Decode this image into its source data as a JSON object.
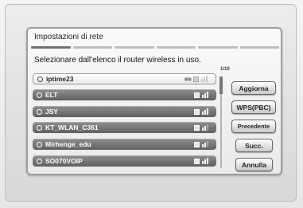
{
  "dialog": {
    "title": "Impostazioni di rete",
    "instruction": "Selezionare dall'elenco il router wireless in uso.",
    "page_counter": "1/10",
    "progress_segments": [
      true,
      false,
      false,
      false,
      false,
      false
    ]
  },
  "networks": [
    {
      "ssid": "iptime23",
      "selected": true,
      "wps": true,
      "signal": 2
    },
    {
      "ssid": "ELT",
      "selected": false,
      "wps": false,
      "signal": 2
    },
    {
      "ssid": "JSY",
      "selected": false,
      "wps": false,
      "signal": 2
    },
    {
      "ssid": "KT_WLAN_C361",
      "selected": false,
      "wps": false,
      "signal": 1
    },
    {
      "ssid": "Mirhenge_edu",
      "selected": false,
      "wps": false,
      "signal": 1
    },
    {
      "ssid": "SO070VOIP",
      "selected": false,
      "wps": false,
      "signal": 2
    }
  ],
  "buttons": {
    "refresh": "Aggiorna",
    "wps": "WPS(PBC)",
    "previous": "Precedente",
    "next": "Succ.",
    "cancel": "Annulla"
  },
  "colors": {
    "row_normal": "#707070",
    "row_selected": "#ffffff",
    "button_face": "#e8e8e8"
  }
}
